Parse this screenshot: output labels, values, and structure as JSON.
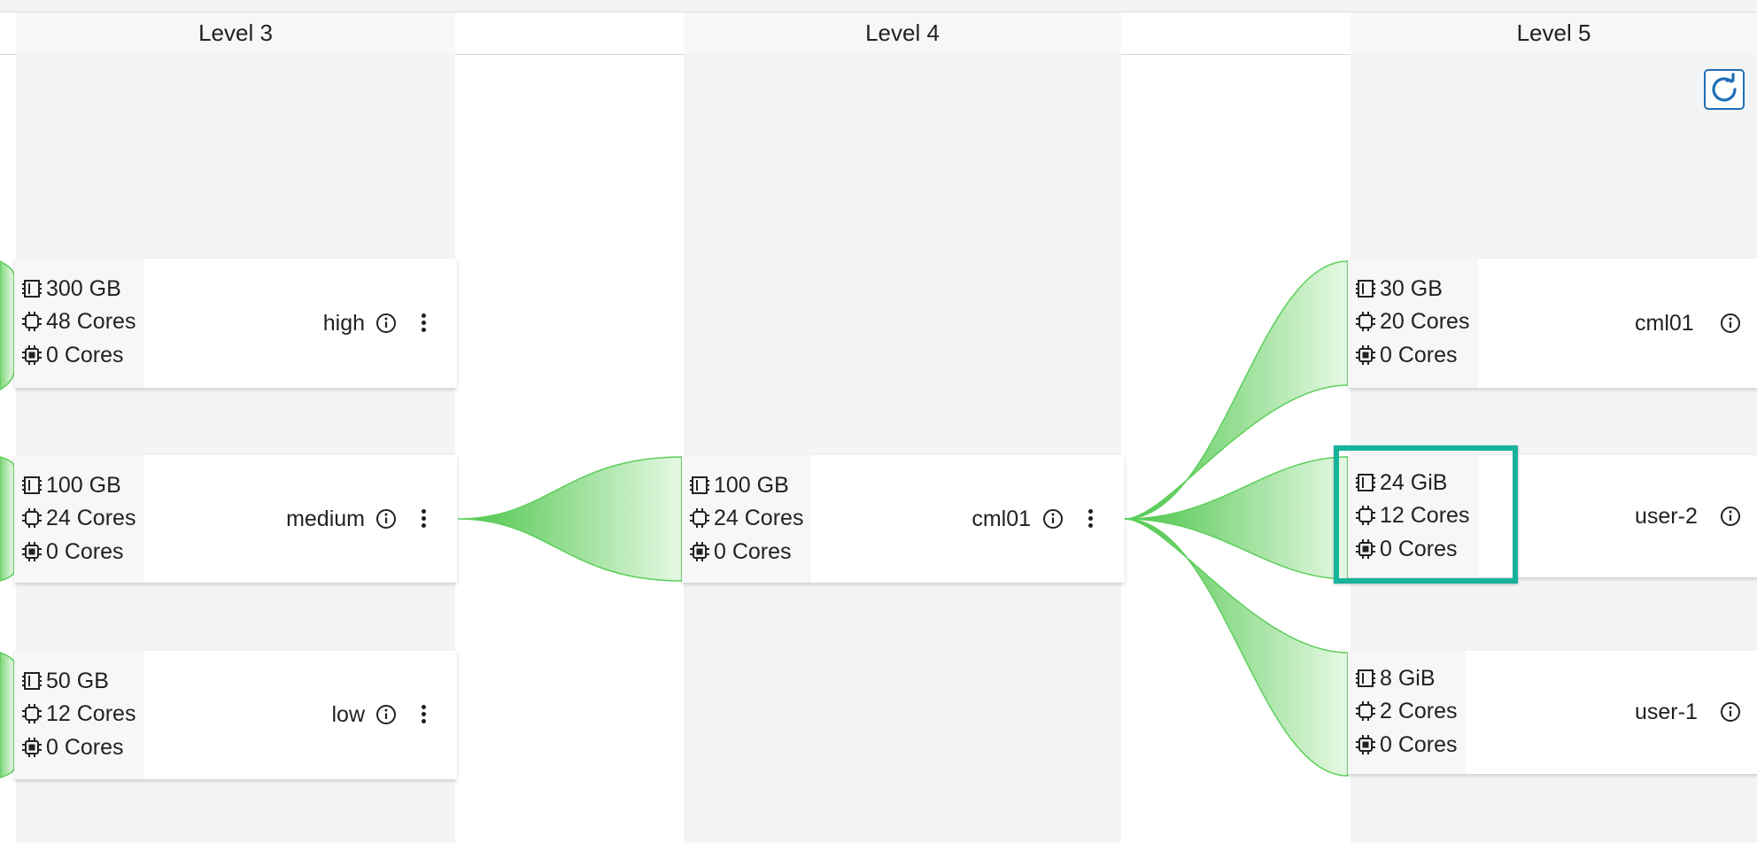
{
  "levels": [
    {
      "title": "Level 3"
    },
    {
      "title": "Level 4"
    },
    {
      "title": "Level 5"
    }
  ],
  "queues": {
    "high": {
      "memory": "300 GB",
      "cpu": "48 Cores",
      "gpu": "0 Cores",
      "name": "high"
    },
    "medium": {
      "memory": "100 GB",
      "cpu": "24 Cores",
      "gpu": "0 Cores",
      "name": "medium"
    },
    "low": {
      "memory": "50 GB",
      "cpu": "12 Cores",
      "gpu": "0 Cores",
      "name": "low"
    },
    "cml01": {
      "memory": "100 GB",
      "cpu": "24 Cores",
      "gpu": "0 Cores",
      "name": "cml01"
    },
    "l5_cml01": {
      "memory": "30 GB",
      "cpu": "20 Cores",
      "gpu": "0 Cores",
      "name": "cml01"
    },
    "user2": {
      "memory": "24 GiB",
      "cpu": "12 Cores",
      "gpu": "0 Cores",
      "name": "user-2"
    },
    "user1": {
      "memory": "8 GiB",
      "cpu": "2 Cores",
      "gpu": "0 Cores",
      "name": "user-1"
    }
  },
  "icons": {
    "memory": "memory-icon",
    "cpu": "cpu-icon",
    "gpu": "gpu-icon",
    "info": "info-icon",
    "menu": "kebab-menu-icon",
    "refresh": "refresh-icon"
  },
  "colors": {
    "flow": "#5ccf5a",
    "highlight": "#16b39a",
    "refresh": "#1f6fb5"
  }
}
